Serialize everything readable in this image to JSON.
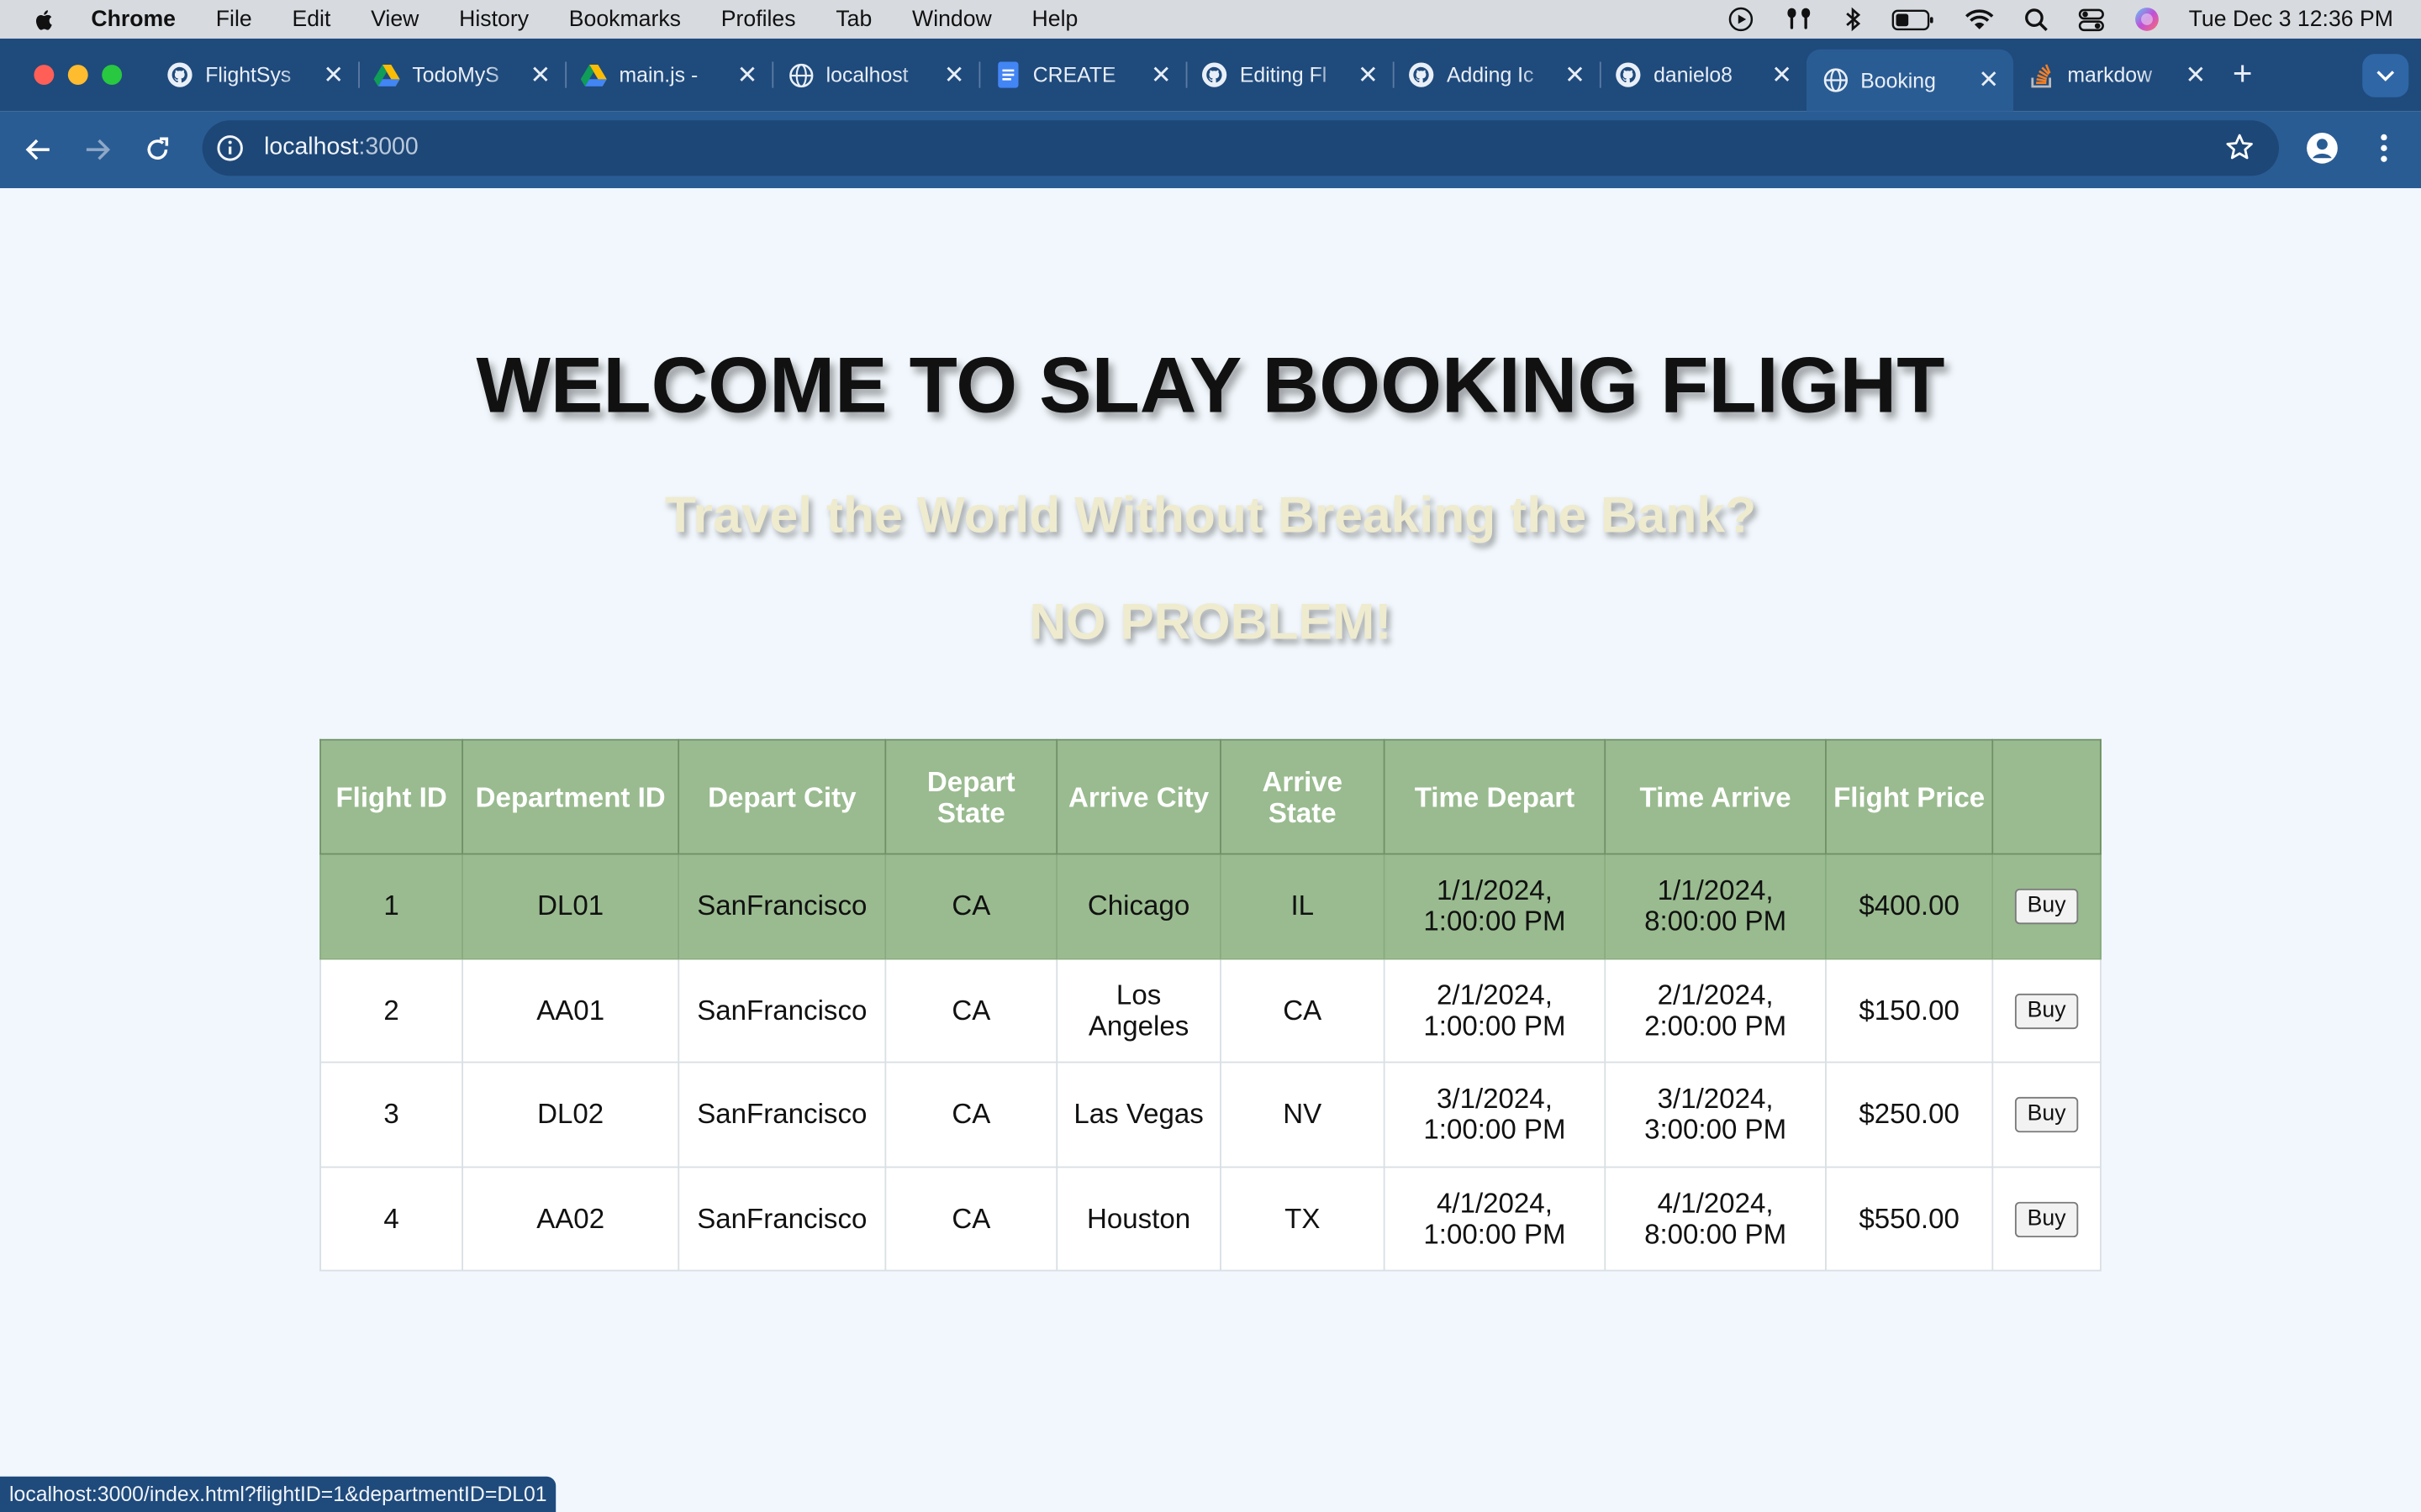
{
  "menubar": {
    "app": "Chrome",
    "items": [
      "File",
      "Edit",
      "View",
      "History",
      "Bookmarks",
      "Profiles",
      "Tab",
      "Window",
      "Help"
    ],
    "clock": "Tue Dec 3  12:36 PM"
  },
  "tabs": [
    {
      "title": "FlightSys",
      "icon": "github-icon"
    },
    {
      "title": "TodoMyS",
      "icon": "google-drive-icon"
    },
    {
      "title": "main.js -",
      "icon": "google-drive-icon"
    },
    {
      "title": "localhost",
      "icon": "globe-icon"
    },
    {
      "title": "CREATE",
      "icon": "google-docs-icon"
    },
    {
      "title": "Editing Fl",
      "icon": "github-icon"
    },
    {
      "title": "Adding Ic",
      "icon": "github-icon"
    },
    {
      "title": "danielo8",
      "icon": "github-icon"
    },
    {
      "title": "Booking",
      "icon": "globe-icon",
      "active": true
    },
    {
      "title": "markdow",
      "icon": "stackoverflow-icon"
    }
  ],
  "address": {
    "host": "localhost",
    "port": ":3000"
  },
  "page": {
    "title": "WELCOME TO SLAY BOOKING FLIGHT",
    "subtitle": "Travel the World Without Breaking the Bank?",
    "tagline": "NO PROBLEM!"
  },
  "table": {
    "headers": [
      "Flight ID",
      "Department ID",
      "Depart City",
      "Depart State",
      "Arrive City",
      "Arrive State",
      "Time Depart",
      "Time Arrive",
      "Flight Price",
      ""
    ],
    "buy_label": "Buy",
    "rows": [
      {
        "id": "1",
        "dept": "DL01",
        "depart_city": "SanFrancisco",
        "depart_state": "CA",
        "arrive_city": "Chicago",
        "arrive_state": "IL",
        "time_depart": "1/1/2024, 1:00:00 PM",
        "time_arrive": "1/1/2024, 8:00:00 PM",
        "price": "$400.00"
      },
      {
        "id": "2",
        "dept": "AA01",
        "depart_city": "SanFrancisco",
        "depart_state": "CA",
        "arrive_city": "Los Angeles",
        "arrive_state": "CA",
        "time_depart": "2/1/2024, 1:00:00 PM",
        "time_arrive": "2/1/2024, 2:00:00 PM",
        "price": "$150.00"
      },
      {
        "id": "3",
        "dept": "DL02",
        "depart_city": "SanFrancisco",
        "depart_state": "CA",
        "arrive_city": "Las Vegas",
        "arrive_state": "NV",
        "time_depart": "3/1/2024, 1:00:00 PM",
        "time_arrive": "3/1/2024, 3:00:00 PM",
        "price": "$250.00"
      },
      {
        "id": "4",
        "dept": "AA02",
        "depart_city": "SanFrancisco",
        "depart_state": "CA",
        "arrive_city": "Houston",
        "arrive_state": "TX",
        "time_depart": "4/1/2024, 1:00:00 PM",
        "time_arrive": "4/1/2024, 8:00:00 PM",
        "price": "$550.00"
      }
    ]
  },
  "status_url": "localhost:3000/index.html?flightID=1&departmentID=DL01",
  "colors": {
    "table_header": "#99bb8f",
    "tab_strip": "#1f4a7c",
    "toolbar": "#2a5c94",
    "page_bg": "#f1f7fc"
  }
}
